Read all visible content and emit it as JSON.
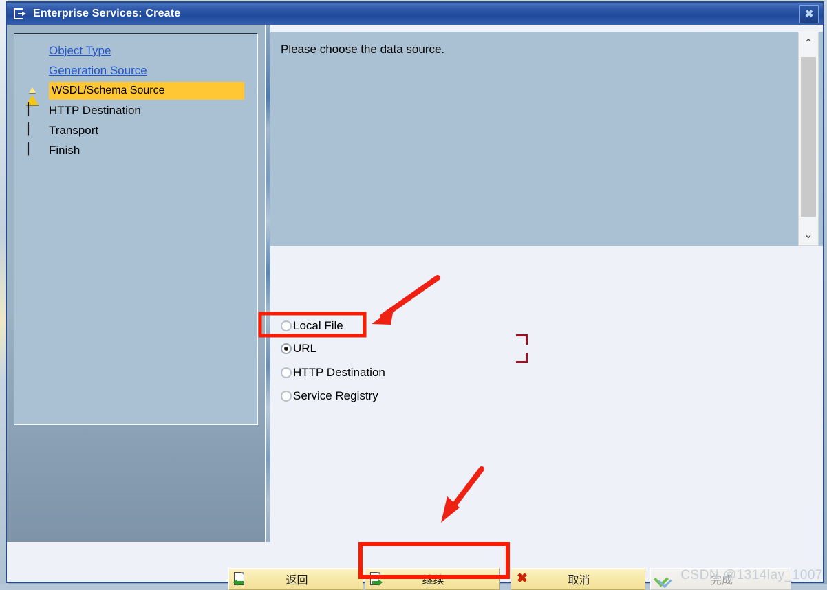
{
  "window": {
    "title": "Enterprise Services: Create",
    "title_icon": "export-window-icon",
    "close_label": "✖"
  },
  "roadmap": {
    "steps": [
      {
        "label": "Object Type",
        "status": "done",
        "icon": "green-circle-icon",
        "link": true
      },
      {
        "label": "Generation Source",
        "status": "done",
        "icon": "green-circle-icon",
        "link": true
      },
      {
        "label": "WSDL/Schema Source",
        "status": "current",
        "icon": "yellow-triangle-icon",
        "link": false
      },
      {
        "label": "HTTP Destination",
        "status": "pending",
        "icon": "red-square-icon",
        "link": false
      },
      {
        "label": "Transport",
        "status": "pending",
        "icon": "red-square-icon",
        "link": false
      },
      {
        "label": "Finish",
        "status": "pending",
        "icon": "red-square-icon",
        "link": false
      }
    ]
  },
  "description": {
    "text": "Please choose the data source.",
    "scrollbar": {
      "up": "⌃",
      "down": "⌄"
    }
  },
  "data_source": {
    "options": [
      {
        "label": "Local File",
        "selected": false
      },
      {
        "label": "URL",
        "selected": true
      },
      {
        "label": "HTTP Destination",
        "selected": false
      },
      {
        "label": "Service Registry",
        "selected": false
      }
    ]
  },
  "footer": {
    "buttons": [
      {
        "label": "返回",
        "icon": "doc-back-icon",
        "disabled": false,
        "highlighted": false
      },
      {
        "label": "继续",
        "icon": "doc-forward-icon",
        "disabled": false,
        "highlighted": true
      },
      {
        "label": "取消",
        "icon": "red-x-icon",
        "disabled": false,
        "highlighted": false
      },
      {
        "label": "完成",
        "icon": "check-icon",
        "disabled": true,
        "highlighted": false
      }
    ]
  },
  "annotations": {
    "highlight_color": "#ff1a00",
    "bracket_color": "#9d1020",
    "arrow_to_url": "arrow-pointing-to-url-option",
    "arrow_to_continue": "arrow-pointing-to-continue-button"
  },
  "watermark": {
    "text": "CSDN @1314lay_1007"
  }
}
